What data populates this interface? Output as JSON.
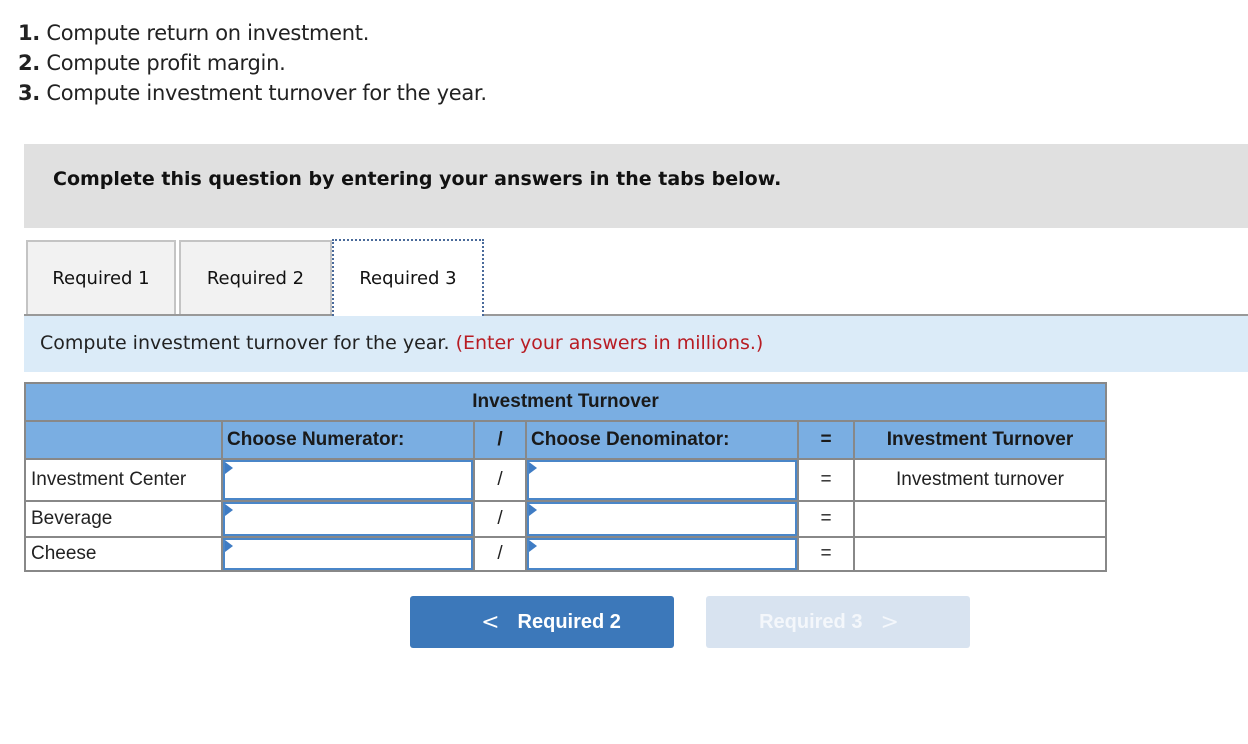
{
  "questions": [
    {
      "num": "1.",
      "text": "Compute return on investment."
    },
    {
      "num": "2.",
      "text": "Compute profit margin."
    },
    {
      "num": "3.",
      "text": "Compute investment turnover for the year."
    }
  ],
  "banner": {
    "text": "Complete this question by entering your answers in the tabs below."
  },
  "tabs": [
    {
      "label": "Required 1",
      "active": false
    },
    {
      "label": "Required 2",
      "active": false
    },
    {
      "label": "Required 3",
      "active": true
    }
  ],
  "instruction": {
    "text": "Compute investment turnover for the year.",
    "hint": "(Enter your answers in millions.)"
  },
  "table": {
    "title": "Investment Turnover",
    "headers": {
      "label": "",
      "numerator": "Choose Numerator:",
      "divide": "/",
      "denominator": "Choose Denominator:",
      "equals": "=",
      "result": "Investment Turnover"
    },
    "rows": [
      {
        "label": "Investment Center",
        "numerator": "",
        "divide": "/",
        "denominator": "",
        "equals": "=",
        "result": "Investment turnover"
      },
      {
        "label": "Beverage",
        "numerator": "",
        "divide": "/",
        "denominator": "",
        "equals": "=",
        "result": ""
      },
      {
        "label": "Cheese",
        "numerator": "",
        "divide": "/",
        "denominator": "",
        "equals": "=",
        "result": ""
      }
    ]
  },
  "nav": {
    "prev": {
      "label": "Required 2",
      "icon": "chevron-left-icon",
      "glyph": "<",
      "enabled": true
    },
    "next": {
      "label": "Required 3",
      "icon": "chevron-right-icon",
      "glyph": ">",
      "enabled": false
    }
  },
  "colors": {
    "accent": "#3c78ba",
    "header_blue": "#7aaee2",
    "instruction_bg": "#dbebf8",
    "hint_red": "#b81c23",
    "banner_gray": "#e0e0e0"
  }
}
